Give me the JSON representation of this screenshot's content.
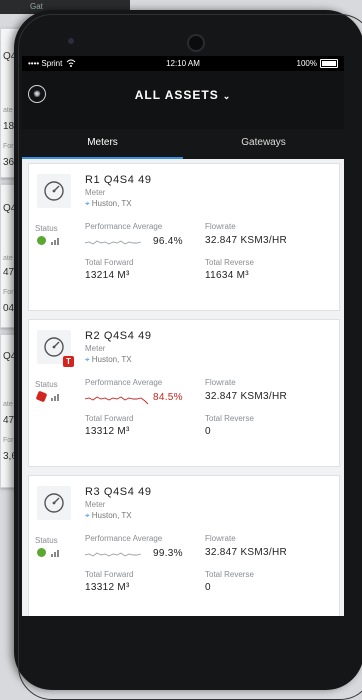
{
  "background": {
    "top_label": "Gat",
    "fragments": [
      "Q4",
      "ate",
      "18",
      "For",
      "36",
      "Q4",
      "ate",
      "47",
      "For",
      "04,",
      "Q4",
      "ate",
      "47",
      "For",
      "3,6"
    ]
  },
  "status_bar": {
    "carrier": "•••• Sprint",
    "time": "12:10 AM",
    "battery": "100%"
  },
  "header": {
    "title": "ALL ASSETS",
    "chevron": "⌄",
    "logo_icon": "company-logo-icon"
  },
  "tabs": [
    {
      "label": "Meters",
      "active": true
    },
    {
      "label": "Gateways",
      "active": false
    }
  ],
  "assets": [
    {
      "name": "R1 Q4S4 49",
      "type": "Meter",
      "location": "Huston, TX",
      "icon": "gauge-icon",
      "alarm": "",
      "status_label": "Status",
      "status_color": "#5aa832",
      "status_kind": "ok",
      "performance_label": "Performance Average",
      "performance_value": "96.4%",
      "performance_alert": false,
      "flowrate_label": "Flowrate",
      "flowrate_value": "32.847 KSM3/HR",
      "total_forward_label": "Total Forward",
      "total_forward_value": "13214 M³",
      "total_reverse_label": "Total Reverse",
      "total_reverse_value": "11634 M³"
    },
    {
      "name": "R2 Q4S4 49",
      "type": "Meter",
      "location": "Huston, TX",
      "icon": "gauge-icon",
      "alarm": "T",
      "status_label": "Status",
      "status_color": "#d3241e",
      "status_kind": "alarm",
      "performance_label": "Performance Average",
      "performance_value": "84.5%",
      "performance_alert": true,
      "flowrate_label": "Flowrate",
      "flowrate_value": "32.847 KSM3/HR",
      "total_forward_label": "Total Forward",
      "total_forward_value": "13312 M³",
      "total_reverse_label": "Total Reverse",
      "total_reverse_value": "0"
    },
    {
      "name": "R3 Q4S4 49",
      "type": "Meter",
      "location": "Huston, TX",
      "icon": "gauge-icon",
      "alarm": "",
      "status_label": "Status",
      "status_color": "#5aa832",
      "status_kind": "ok",
      "performance_label": "Performance Average",
      "performance_value": "99.3%",
      "performance_alert": false,
      "flowrate_label": "Flowrate",
      "flowrate_value": "32.847 KSM3/HR",
      "total_forward_label": "Total Forward",
      "total_forward_value": "13312 M³",
      "total_reverse_label": "Total Reverse",
      "total_reverse_value": "0"
    }
  ],
  "colors": {
    "accent": "#3b8fe2",
    "ok": "#5aa832",
    "alarm": "#d3241e",
    "header_bg": "#111214"
  }
}
